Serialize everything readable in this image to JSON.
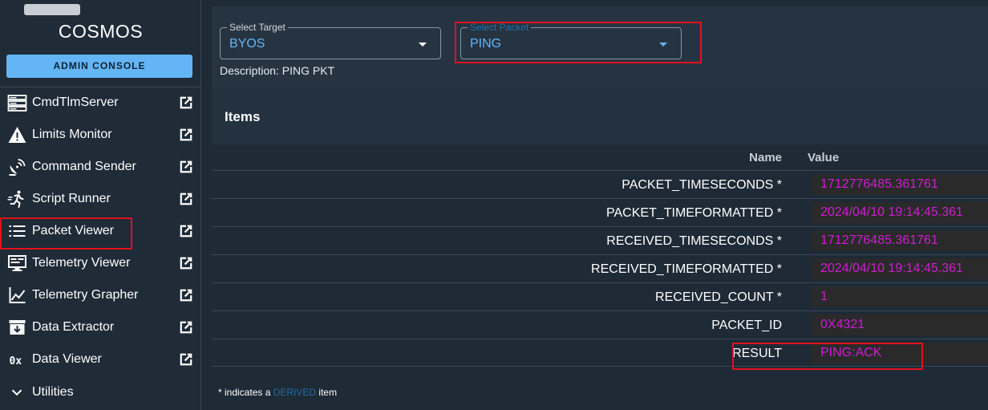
{
  "app": {
    "title": "COSMOS",
    "admin_button": "ADMIN CONSOLE"
  },
  "sidebar": {
    "items": [
      {
        "label": "CmdTlmServer",
        "icon": "server-icon"
      },
      {
        "label": "Limits Monitor",
        "icon": "warning-icon"
      },
      {
        "label": "Command Sender",
        "icon": "satellite-dish-icon"
      },
      {
        "label": "Script Runner",
        "icon": "running-person-icon"
      },
      {
        "label": "Packet Viewer",
        "icon": "list-icon"
      },
      {
        "label": "Telemetry Viewer",
        "icon": "monitor-icon"
      },
      {
        "label": "Telemetry Grapher",
        "icon": "line-chart-icon"
      },
      {
        "label": "Data Extractor",
        "icon": "archive-download-icon"
      },
      {
        "label": "Data Viewer",
        "icon": "hex-icon"
      }
    ],
    "utilities_label": "Utilities"
  },
  "packet_viewer": {
    "target": {
      "legend": "Select Target",
      "value": "BYOS"
    },
    "packet": {
      "legend": "Select Packet",
      "value": "PING"
    },
    "description": "Description: PING PKT",
    "items_title": "Items",
    "columns": {
      "name": "Name",
      "value": "Value"
    },
    "rows": [
      {
        "name": "PACKET_TIMESECONDS *",
        "value": "1712776485.361761"
      },
      {
        "name": "PACKET_TIMEFORMATTED *",
        "value": "2024/04/10 19:14:45.361"
      },
      {
        "name": "RECEIVED_TIMESECONDS *",
        "value": "1712776485.361761"
      },
      {
        "name": "RECEIVED_TIMEFORMATTED *",
        "value": "2024/04/10 19:14:45.361"
      },
      {
        "name": "RECEIVED_COUNT *",
        "value": "1"
      },
      {
        "name": "PACKET_ID",
        "value": "0X4321"
      },
      {
        "name": "RESULT",
        "value": "PING:ACK"
      }
    ],
    "footnote": {
      "prefix": "* indicates a",
      "derived": "DERIVED",
      "suffix": "item"
    }
  },
  "colors": {
    "accent": "#64b5f6",
    "value_text": "#d01cd2",
    "highlight": "#e3101e"
  }
}
